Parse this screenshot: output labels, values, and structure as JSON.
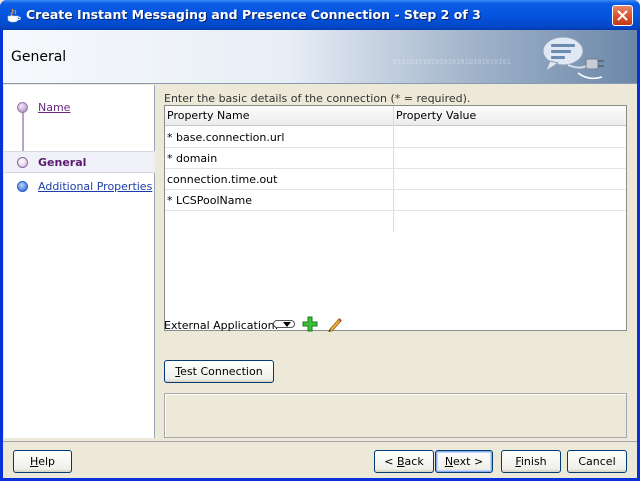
{
  "window": {
    "title": "Create Instant Messaging and Presence Connection - Step 2 of 3"
  },
  "header": {
    "title": "General",
    "binary_text": "0101010101010101010101010101",
    "icon": "speech-bubble-plug-icon"
  },
  "nav": {
    "items": [
      {
        "label": "Name",
        "state": "visited"
      },
      {
        "label": "General",
        "state": "current"
      },
      {
        "label": "Additional Properties",
        "state": "next"
      }
    ]
  },
  "main": {
    "instructions": "Enter the basic details of the connection (* = required).",
    "table": {
      "columns": [
        "Property Name",
        "Property Value"
      ],
      "rows": [
        {
          "name": "* base.connection.url",
          "value": ""
        },
        {
          "name": "* domain",
          "value": ""
        },
        {
          "name": "connection.time.out",
          "value": ""
        },
        {
          "name": "* LCSPoolName",
          "value": ""
        }
      ]
    },
    "external_application": {
      "label": "External Application:",
      "selected": ""
    },
    "test_connection": {
      "prefix": "",
      "mnemonic": "T",
      "rest": "est Connection"
    }
  },
  "footer": {
    "help": {
      "mnemonic": "H",
      "rest": "elp"
    },
    "back": {
      "prefix": "< ",
      "mnemonic": "B",
      "rest": "ack"
    },
    "next": {
      "prefix": "",
      "mnemonic": "N",
      "rest": "ext >"
    },
    "finish": {
      "mnemonic": "F",
      "rest": "inish"
    },
    "cancel": {
      "label": "Cancel"
    }
  },
  "colors": {
    "titlebar": "#0554e0",
    "nav_visited": "#6b2a80",
    "nav_current": "#5a1a70",
    "nav_link": "#1a3ea8"
  }
}
